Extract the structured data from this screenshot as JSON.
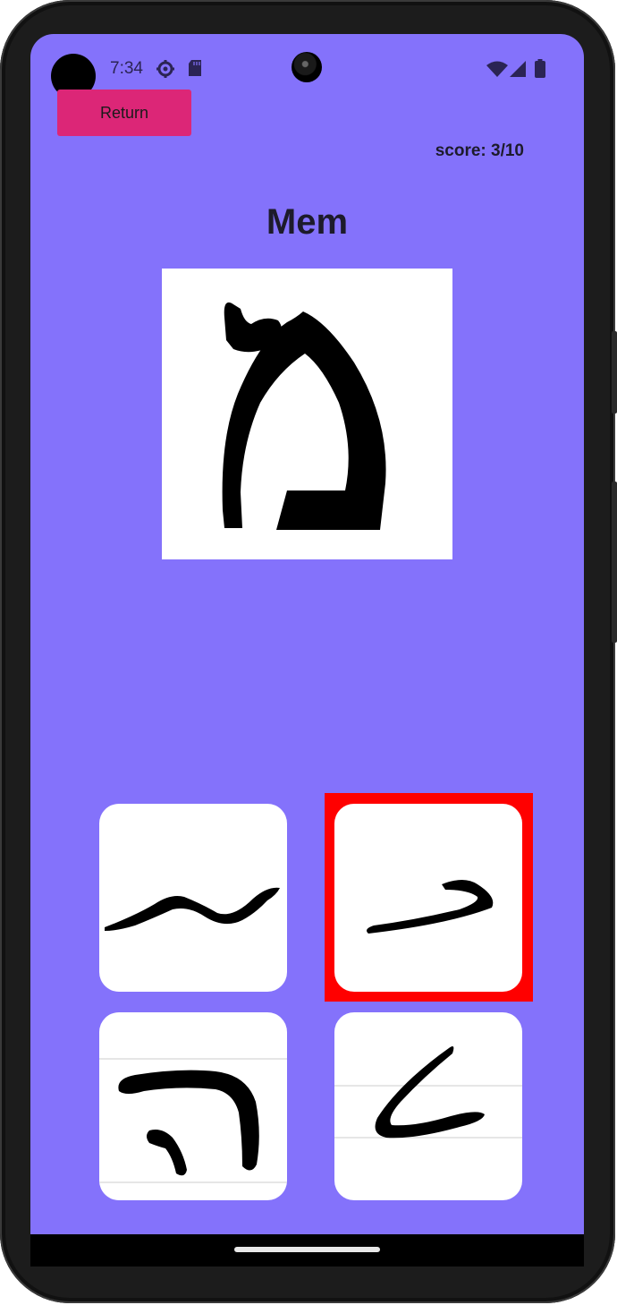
{
  "status_bar": {
    "time": "7:34",
    "icons": [
      "settings-gear-icon",
      "sd-card-icon",
      "wifi-icon",
      "cell-signal-icon",
      "battery-icon"
    ]
  },
  "header": {
    "return_label": "Return",
    "score_label": "score: 3/10"
  },
  "question": {
    "letter_name": "Mem",
    "letter_image": "hebrew-mem-glyph"
  },
  "options": [
    {
      "glyph": "handwritten-tilde-stroke",
      "selected": false
    },
    {
      "glyph": "handwritten-kaf-sofit-stroke",
      "selected": true
    },
    {
      "glyph": "handwritten-he-stroke",
      "selected": false
    },
    {
      "glyph": "handwritten-lamed-stroke",
      "selected": false
    }
  ],
  "colors": {
    "background": "#8472fb",
    "return_button": "#dc2677",
    "selection_border": "#ff0000",
    "card": "#ffffff",
    "text": "#1d1b2b"
  }
}
